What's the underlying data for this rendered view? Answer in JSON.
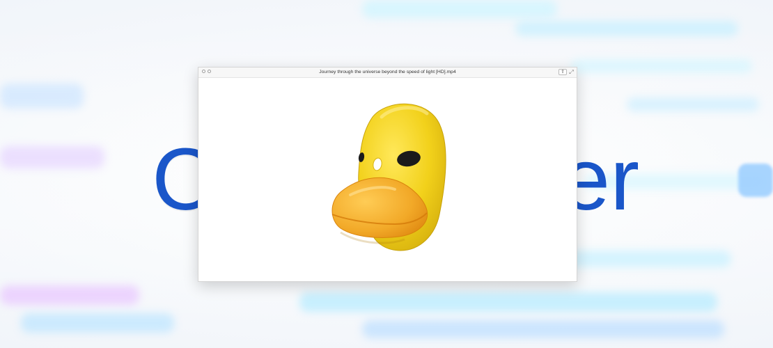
{
  "background": {
    "brand_left": "C",
    "brand_right": "er",
    "brand_color": "#1a56c9"
  },
  "window": {
    "title": "Journey through the universe beyond the speed of light [HD].mp4",
    "share_icon": "share-icon",
    "expand_icon": "expand-icon"
  },
  "colors": {
    "duck_yellow": "#f2d11b",
    "duck_orange": "#f2a928"
  }
}
